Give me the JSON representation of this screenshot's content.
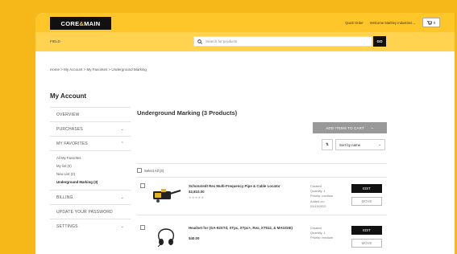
{
  "header": {
    "logo_text_left": "CORE",
    "logo_text_amp": "&",
    "logo_text_right": "MAIN",
    "quick_order": "Quick Order",
    "welcome": "Welcome Markley Industries",
    "cart_label": "0"
  },
  "search": {
    "field_label": "FIELD",
    "placeholder": "Search for products",
    "go_label": "GO"
  },
  "breadcrumb": "Home  >  My Account  >  My Favorites  >  Underground Marking",
  "account_title": "My Account",
  "sidebar": {
    "overview": "OVERVIEW",
    "purchases": "PURCHASES",
    "my_favorites": "MY FAVORITES",
    "sub_items": [
      "All My Favorites",
      "My list (0)",
      "New List (0)",
      "Underground Marking (3)"
    ],
    "billing": "BILLING",
    "update_password": "UPDATE YOUR PASSWORD",
    "settings": "SETTINGS"
  },
  "main": {
    "title": "Underground Marking (3 Products)",
    "add_to_cart": "ADD ITEMS TO CART",
    "sort_label": "Sort by name",
    "select_all": "Select All (3)"
  },
  "items": [
    {
      "name": "Schonstedt Rex Multi-Frequency Pipe & Cable Locator",
      "price": "$2,810.00",
      "stars": "★★★★★",
      "meta": [
        "Created",
        "Quantity:  1",
        "Priority:  medium",
        "Added on:",
        "03/15/2022"
      ],
      "edit": "EDIT",
      "move": "MOVE"
    },
    {
      "name": "Headset for (GA-92XTd, XTpc, XTpc+, Rex, XT512, & MAGGIE)",
      "price": "$40.00",
      "stars": "",
      "meta": [
        "Created",
        "Quantity:  1",
        "Priority:  medium"
      ],
      "edit": "EDIT",
      "move": "MOVE"
    }
  ],
  "colors": {
    "brand_yellow": "#ffc629",
    "background_yellow": "#f5b818",
    "button_black": "#111111",
    "button_gray": "#999999"
  },
  "icons": [
    "search-icon",
    "cart-icon",
    "chevron-down-icon",
    "chevron-up-icon",
    "sort-icon"
  ]
}
